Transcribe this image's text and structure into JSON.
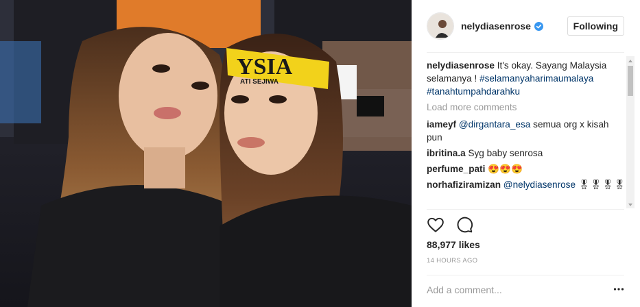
{
  "post": {
    "username": "nelydiasenrose",
    "follow_label": "Following"
  },
  "caption": {
    "username": "nelydiasenrose",
    "text": "It's okay. Sayang Malaysia selamanya !",
    "hashtag_1": "#selamanyaharimaumalaya",
    "hashtag_2": "#tanahtumpahdarahku"
  },
  "load_more_label": "Load more comments",
  "comments": [
    {
      "user": "iameyf",
      "mention": "@dirgantara_esa",
      "text": "semua org x kisah pun"
    },
    {
      "user": "ibritina.a",
      "mention": "",
      "text": "Syg baby senrosa"
    },
    {
      "user": "perfume_pati",
      "mention": "",
      "text": "😍😍😍"
    },
    {
      "user": "norhafiziramizan",
      "mention": "@nelydiasenrose",
      "text": "🎖🎖🎖🎖"
    }
  ],
  "likes_label": "88,977 likes",
  "time_label": "14 HOURS AGO",
  "comment_placeholder": "Add a comment...",
  "headband_text": "YSIA",
  "headband_small": "ATI SEJIWA",
  "colors": {
    "link": "#003569",
    "muted": "#999999",
    "verified": "#3897f0",
    "headband": "#f2d21b"
  },
  "icons": [
    "heart-icon",
    "comment-icon",
    "verified-badge-icon",
    "more-options-icon"
  ]
}
